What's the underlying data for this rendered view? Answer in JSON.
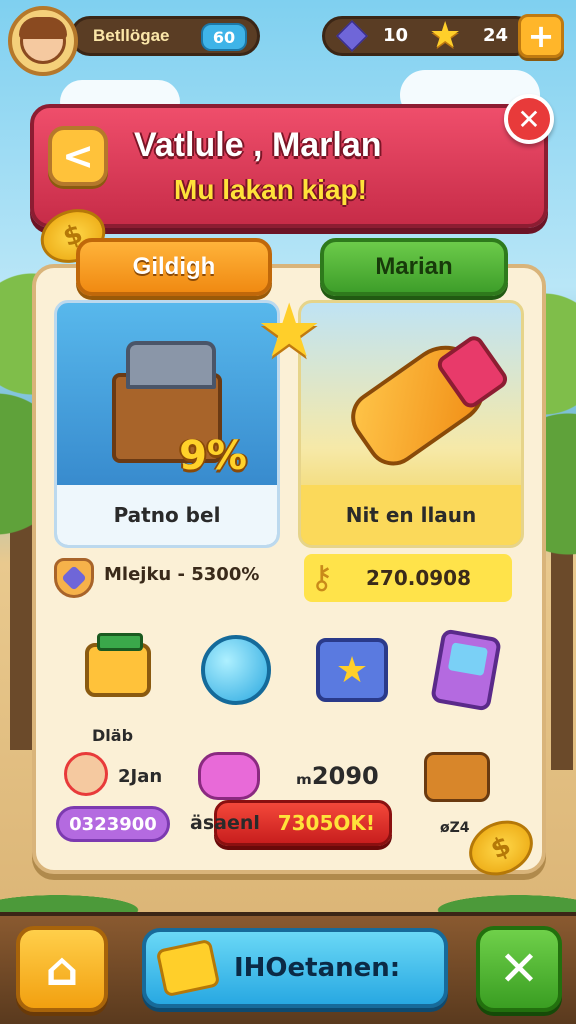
{
  "topbar": {
    "player_name": "Betllögae",
    "level": "60",
    "gems": "10",
    "stars": "24",
    "plus_label": "+"
  },
  "banner": {
    "title": "Vatlule , Marlan",
    "subtitle": "Mu lakan kiap!",
    "back_label": "<",
    "close_label": "✕"
  },
  "tabs": [
    {
      "label": "Gildigh"
    },
    {
      "label": "Marian"
    }
  ],
  "cards": [
    {
      "badge": "9%",
      "footer": "Patno bel"
    },
    {
      "footer": "Nit en llaun"
    }
  ],
  "stats": {
    "left": "Mlejku - 5300%",
    "right": "270.0908"
  },
  "items": {
    "label_1": "Dläb",
    "label_2": "2Jan",
    "label_3": "ₘ2090",
    "label_4": "øZ4",
    "purple_pill": "0323900",
    "red_button_prefix": "äsaenl",
    "red_button": "7305OK!"
  },
  "bottombar": {
    "main_label": "IHOetanen:",
    "left_icon_label": "⌂",
    "right_icon_label": "✕"
  },
  "colors": {
    "banner": "#e23e5c",
    "tab_orange": "#f5a224",
    "tab_green": "#52b536",
    "bottom_blue": "#3cbcee"
  }
}
